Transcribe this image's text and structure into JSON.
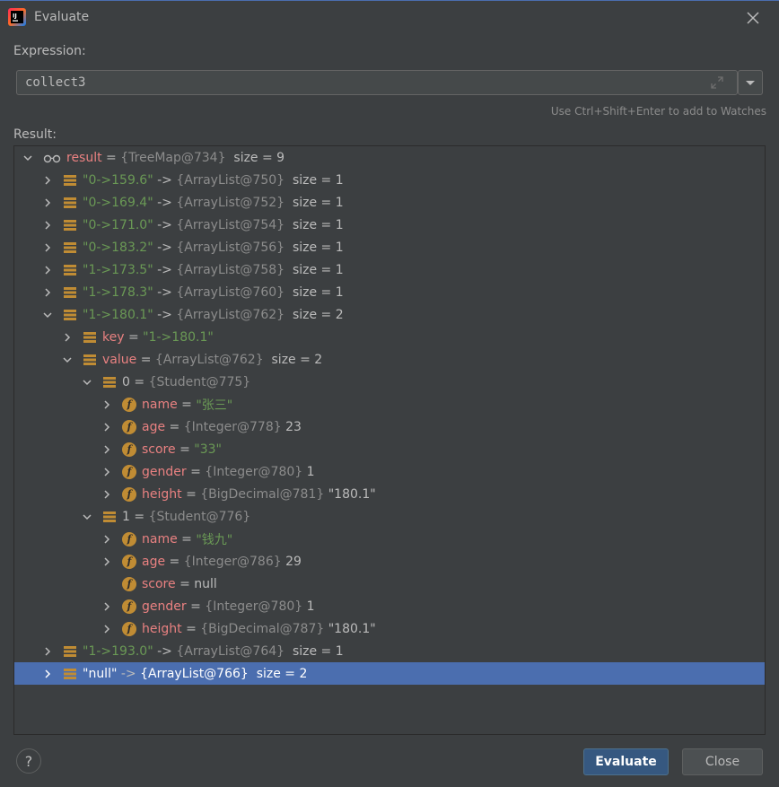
{
  "window": {
    "title": "Evaluate"
  },
  "expression": {
    "label": "Expression:",
    "value": "collect3"
  },
  "hint": "Use Ctrl+Shift+Enter to add to Watches",
  "result_label": "Result:",
  "tree": [
    {
      "level": 0,
      "toggle": "expanded",
      "icon": "watch",
      "name": "result",
      "name_style": "red",
      "eq": " = ",
      "type": "{TreeMap@734}",
      "value": "  size = 9"
    },
    {
      "level": 1,
      "toggle": "collapsed",
      "icon": "list",
      "name": "\"0->159.6\"",
      "name_style": "green",
      "eq": " -> ",
      "type": "{ArrayList@750}",
      "value": "  size = 1"
    },
    {
      "level": 1,
      "toggle": "collapsed",
      "icon": "list",
      "name": "\"0->169.4\"",
      "name_style": "green",
      "eq": " -> ",
      "type": "{ArrayList@752}",
      "value": "  size = 1"
    },
    {
      "level": 1,
      "toggle": "collapsed",
      "icon": "list",
      "name": "\"0->171.0\"",
      "name_style": "green",
      "eq": " -> ",
      "type": "{ArrayList@754}",
      "value": "  size = 1"
    },
    {
      "level": 1,
      "toggle": "collapsed",
      "icon": "list",
      "name": "\"0->183.2\"",
      "name_style": "green",
      "eq": " -> ",
      "type": "{ArrayList@756}",
      "value": "  size = 1"
    },
    {
      "level": 1,
      "toggle": "collapsed",
      "icon": "list",
      "name": "\"1->173.5\"",
      "name_style": "green",
      "eq": " -> ",
      "type": "{ArrayList@758}",
      "value": "  size = 1"
    },
    {
      "level": 1,
      "toggle": "collapsed",
      "icon": "list",
      "name": "\"1->178.3\"",
      "name_style": "green",
      "eq": " -> ",
      "type": "{ArrayList@760}",
      "value": "  size = 1"
    },
    {
      "level": 1,
      "toggle": "expanded",
      "icon": "list",
      "name": "\"1->180.1\"",
      "name_style": "green",
      "eq": " -> ",
      "type": "{ArrayList@762}",
      "value": "  size = 2"
    },
    {
      "level": 2,
      "toggle": "collapsed",
      "icon": "list",
      "name": "key",
      "name_style": "red",
      "eq": " = ",
      "type": "",
      "value": "\"1->180.1\"",
      "value_style": "green"
    },
    {
      "level": 2,
      "toggle": "expanded",
      "icon": "list",
      "name": "value",
      "name_style": "red",
      "eq": " = ",
      "type": "{ArrayList@762}",
      "value": "  size = 2"
    },
    {
      "level": 3,
      "toggle": "expanded",
      "icon": "list",
      "name": "0",
      "name_style": "white",
      "eq": " = ",
      "type": "{Student@775}",
      "value": ""
    },
    {
      "level": 4,
      "toggle": "collapsed",
      "icon": "field",
      "name": "name",
      "name_style": "red",
      "eq": " = ",
      "type": "",
      "value": "\"张三\"",
      "value_style": "green"
    },
    {
      "level": 4,
      "toggle": "collapsed",
      "icon": "field",
      "name": "age",
      "name_style": "red",
      "eq": " = ",
      "type": "{Integer@778}",
      "value": " 23"
    },
    {
      "level": 4,
      "toggle": "collapsed",
      "icon": "field",
      "name": "score",
      "name_style": "red",
      "eq": " = ",
      "type": "",
      "value": "\"33\"",
      "value_style": "green"
    },
    {
      "level": 4,
      "toggle": "collapsed",
      "icon": "field",
      "name": "gender",
      "name_style": "red",
      "eq": " = ",
      "type": "{Integer@780}",
      "value": " 1"
    },
    {
      "level": 4,
      "toggle": "collapsed",
      "icon": "field",
      "name": "height",
      "name_style": "red",
      "eq": " = ",
      "type": "{BigDecimal@781}",
      "value": " \"180.1\""
    },
    {
      "level": 3,
      "toggle": "expanded",
      "icon": "list",
      "name": "1",
      "name_style": "white",
      "eq": " = ",
      "type": "{Student@776}",
      "value": ""
    },
    {
      "level": 4,
      "toggle": "collapsed",
      "icon": "field",
      "name": "name",
      "name_style": "red",
      "eq": " = ",
      "type": "",
      "value": "\"钱九\"",
      "value_style": "green"
    },
    {
      "level": 4,
      "toggle": "collapsed",
      "icon": "field",
      "name": "age",
      "name_style": "red",
      "eq": " = ",
      "type": "{Integer@786}",
      "value": " 29"
    },
    {
      "level": 4,
      "toggle": "none",
      "icon": "field",
      "name": "score",
      "name_style": "red",
      "eq": " = ",
      "type": "",
      "value": "null"
    },
    {
      "level": 4,
      "toggle": "collapsed",
      "icon": "field",
      "name": "gender",
      "name_style": "red",
      "eq": " = ",
      "type": "{Integer@780}",
      "value": " 1"
    },
    {
      "level": 4,
      "toggle": "collapsed",
      "icon": "field",
      "name": "height",
      "name_style": "red",
      "eq": " = ",
      "type": "{BigDecimal@787}",
      "value": " \"180.1\""
    },
    {
      "level": 1,
      "toggle": "collapsed",
      "icon": "list",
      "name": "\"1->193.0\"",
      "name_style": "green",
      "eq": " -> ",
      "type": "{ArrayList@764}",
      "value": "  size = 1"
    },
    {
      "level": 1,
      "toggle": "collapsed",
      "icon": "list",
      "name": "\"null\"",
      "name_style": "white",
      "eq": " -> ",
      "type": "{ArrayList@766}",
      "value": "  size = 2",
      "selected": true
    }
  ],
  "buttons": {
    "help": "?",
    "evaluate": "Evaluate",
    "close": "Close"
  },
  "colors": {
    "background": "#3c3f41",
    "selection": "#4b6eaf",
    "field_icon": "#c08c34",
    "name_red": "#e98181",
    "string_green": "#6a9955"
  }
}
